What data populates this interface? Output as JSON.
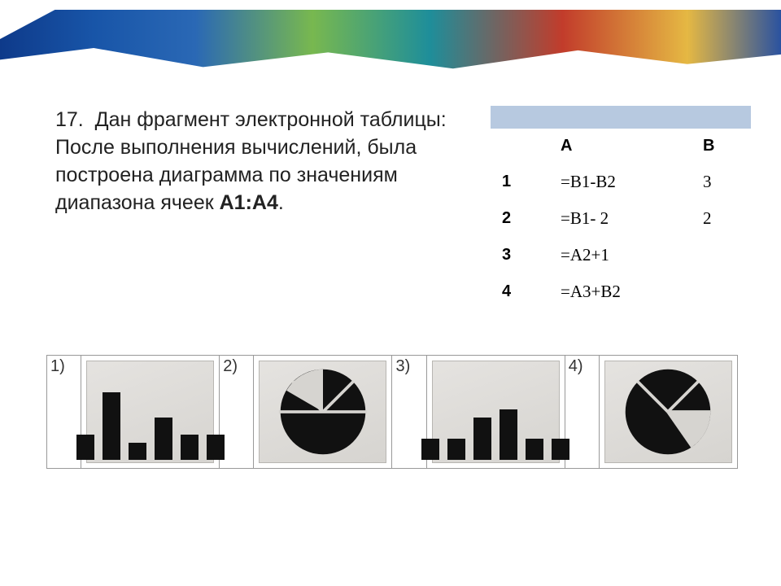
{
  "question": {
    "number": "17.",
    "line1": "Дан фрагмент электронной таблицы:",
    "line2": "После выполнения вычислений, была построена диаграмма по значениям диапазона ячеек",
    "range_bold": "A1:A4",
    "period": "."
  },
  "sheet": {
    "col_a": "A",
    "col_b": "B",
    "rows": [
      {
        "num": "1",
        "a": "=B1-B2",
        "b": "3"
      },
      {
        "num": "2",
        "a": "=B1- 2",
        "b": "2"
      },
      {
        "num": "3",
        "a": "=A2+1",
        "b": ""
      },
      {
        "num": "4",
        "a": "=A3+B2",
        "b": ""
      }
    ]
  },
  "chart_data": [
    {
      "option": "1",
      "type": "bar",
      "values": [
        30,
        80,
        20,
        50,
        30,
        30
      ],
      "ylim": [
        0,
        100
      ]
    },
    {
      "option": "2",
      "type": "pie",
      "values": [
        25,
        25,
        50
      ]
    },
    {
      "option": "3",
      "type": "bar",
      "values": [
        25,
        25,
        50,
        60,
        25,
        25
      ],
      "ylim": [
        0,
        100
      ]
    },
    {
      "option": "4",
      "type": "pie",
      "values": [
        35,
        35,
        10,
        20
      ]
    }
  ],
  "choices": {
    "n1": "1)",
    "n2": "2)",
    "n3": "3)",
    "n4": "4)"
  }
}
